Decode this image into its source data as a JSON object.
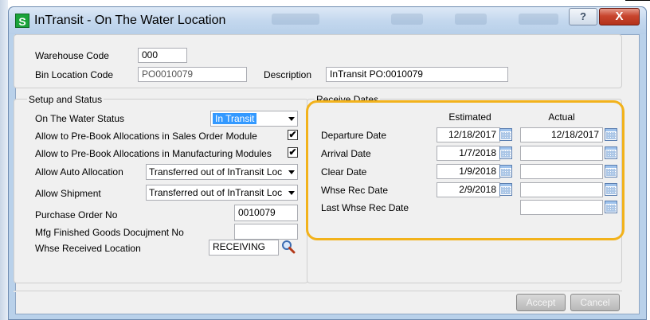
{
  "window": {
    "title": "InTransit - On The Water Location",
    "app_icon_letter": "S",
    "help_glyph": "?",
    "close_glyph": "X"
  },
  "top": {
    "warehouse_code_label": "Warehouse Code",
    "warehouse_code_value": "000",
    "bin_location_label": "Bin Location Code",
    "bin_location_value": "PO0010079",
    "description_label": "Description",
    "description_value": "InTransit PO:0010079"
  },
  "setup": {
    "group_label": "Setup and Status",
    "on_the_water_status_label": "On The Water Status",
    "on_the_water_status_value": "In Transit",
    "prebook_sales_label": "Allow to Pre-Book Allocations in Sales Order Module",
    "prebook_sales_checked": "✔",
    "prebook_mfg_label": "Allow to Pre-Book Allocations in Manufacturing Modules",
    "prebook_mfg_checked": "✔",
    "auto_allocation_label": "Allow Auto Allocation",
    "auto_allocation_value": "Transferred out of InTransit Loc",
    "allow_shipment_label": "Allow Shipment",
    "allow_shipment_value": "Transferred out of InTransit Loc",
    "purchase_order_label": "Purchase Order No",
    "purchase_order_value": "0010079",
    "mfg_doc_label": "Mfg Finished Goods Docujment No",
    "mfg_doc_value": "",
    "whse_received_label": "Whse Received Location",
    "whse_received_value": "RECEIVING"
  },
  "receive_dates": {
    "group_label": "Receive Dates",
    "col_estimated": "Estimated",
    "col_actual": "Actual",
    "rows": [
      {
        "label": "Departure Date",
        "estimated": "12/18/2017",
        "actual": "12/18/2017"
      },
      {
        "label": "Arrival Date",
        "estimated": "1/7/2018",
        "actual": ""
      },
      {
        "label": "Clear Date",
        "estimated": "1/9/2018",
        "actual": ""
      },
      {
        "label": "Whse Rec Date",
        "estimated": "2/9/2018",
        "actual": ""
      },
      {
        "label": "Last Whse Rec Date",
        "estimated": null,
        "actual": ""
      }
    ]
  },
  "buttons": {
    "accept": "Accept",
    "cancel": "Cancel"
  },
  "colors": {
    "highlight": "#f2b21b",
    "selection": "#3399ff",
    "close_button": "#c8452e"
  }
}
